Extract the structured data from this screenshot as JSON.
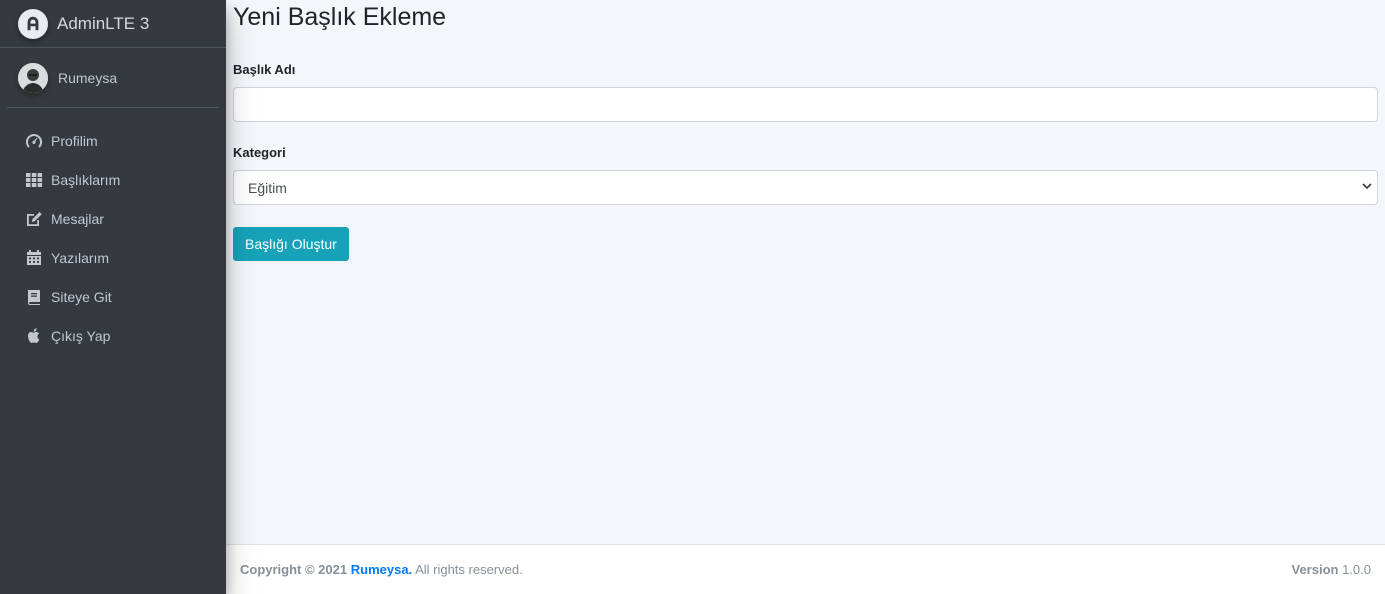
{
  "brand": {
    "name": "AdminLTE 3",
    "icon": "adminlte-logo-icon"
  },
  "user": {
    "name": "Rumeysa",
    "avatar": "user-avatar"
  },
  "sidebar": {
    "items": [
      {
        "label": "Profilim",
        "icon": "tachometer-icon"
      },
      {
        "label": "Başlıklarım",
        "icon": "grid-icon"
      },
      {
        "label": "Mesajlar",
        "icon": "edit-icon"
      },
      {
        "label": "Yazılarım",
        "icon": "calendar-icon"
      },
      {
        "label": "Siteye Git",
        "icon": "book-icon"
      },
      {
        "label": "Çıkış Yap",
        "icon": "apple-icon"
      }
    ]
  },
  "page": {
    "title": "Yeni Başlık Ekleme",
    "title_field": {
      "label": "Başlık Adı",
      "value": "",
      "placeholder": ""
    },
    "category_field": {
      "label": "Kategori",
      "selected": "Eğitim"
    },
    "submit_label": "Başlığı Oluştur"
  },
  "footer": {
    "copyright": "Copyright © 2021",
    "owner": "Rumeysa.",
    "rights": "All rights reserved.",
    "version_label": "Version",
    "version": "1.0.0"
  },
  "colors": {
    "sidebar_bg": "#343a40",
    "accent": "#17a2b8",
    "link": "#007bff",
    "content_bg": "#f4f6f9"
  }
}
